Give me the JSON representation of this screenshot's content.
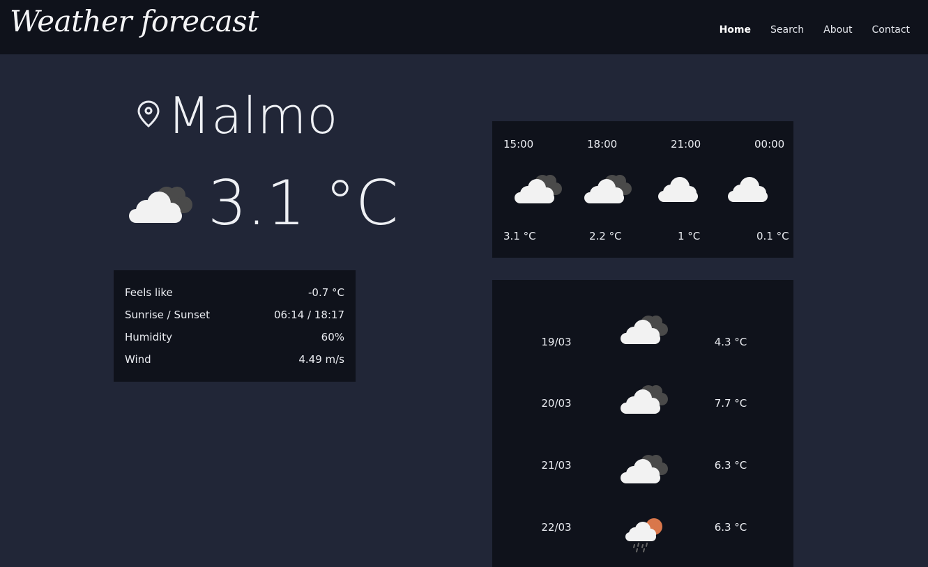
{
  "app": {
    "brand": "Weather forecast"
  },
  "nav": {
    "items": [
      "Home",
      "Search",
      "About",
      "Contact"
    ],
    "active": "Home"
  },
  "location": {
    "city": "Malmo",
    "icon": "location-pin-icon"
  },
  "current": {
    "temp": "3.1 °C",
    "icon": "cloudy-icon"
  },
  "details": [
    {
      "label": "Feels like",
      "value": "-0.7 °C"
    },
    {
      "label": "Sunrise / Sunset",
      "value": "06:14 / 18:17"
    },
    {
      "label": "Humidity",
      "value": "60%"
    },
    {
      "label": "Wind",
      "value": "4.49 m/s"
    }
  ],
  "hourly": [
    {
      "time": "15:00",
      "temp": "3.1 °C",
      "icon": "cloudy-icon"
    },
    {
      "time": "18:00",
      "temp": "2.2 °C",
      "icon": "cloudy-icon"
    },
    {
      "time": "21:00",
      "temp": "1 °C",
      "icon": "cloud-icon"
    },
    {
      "time": "00:00",
      "temp": "0.1 °C",
      "icon": "cloud-icon"
    }
  ],
  "daily": [
    {
      "date": "19/03",
      "temp": "4.3 °C",
      "icon": "cloudy-icon"
    },
    {
      "date": "20/03",
      "temp": "7.7 °C",
      "icon": "cloudy-icon"
    },
    {
      "date": "21/03",
      "temp": "6.3 °C",
      "icon": "cloudy-icon"
    },
    {
      "date": "22/03",
      "temp": "6.3 °C",
      "icon": "rain-sun-icon"
    }
  ],
  "colors": {
    "background": "#212637",
    "panel": "#0f121b",
    "cloud_front": "#f2f2f2",
    "cloud_back": "#4a4a4a",
    "sun": "#d9774b"
  }
}
